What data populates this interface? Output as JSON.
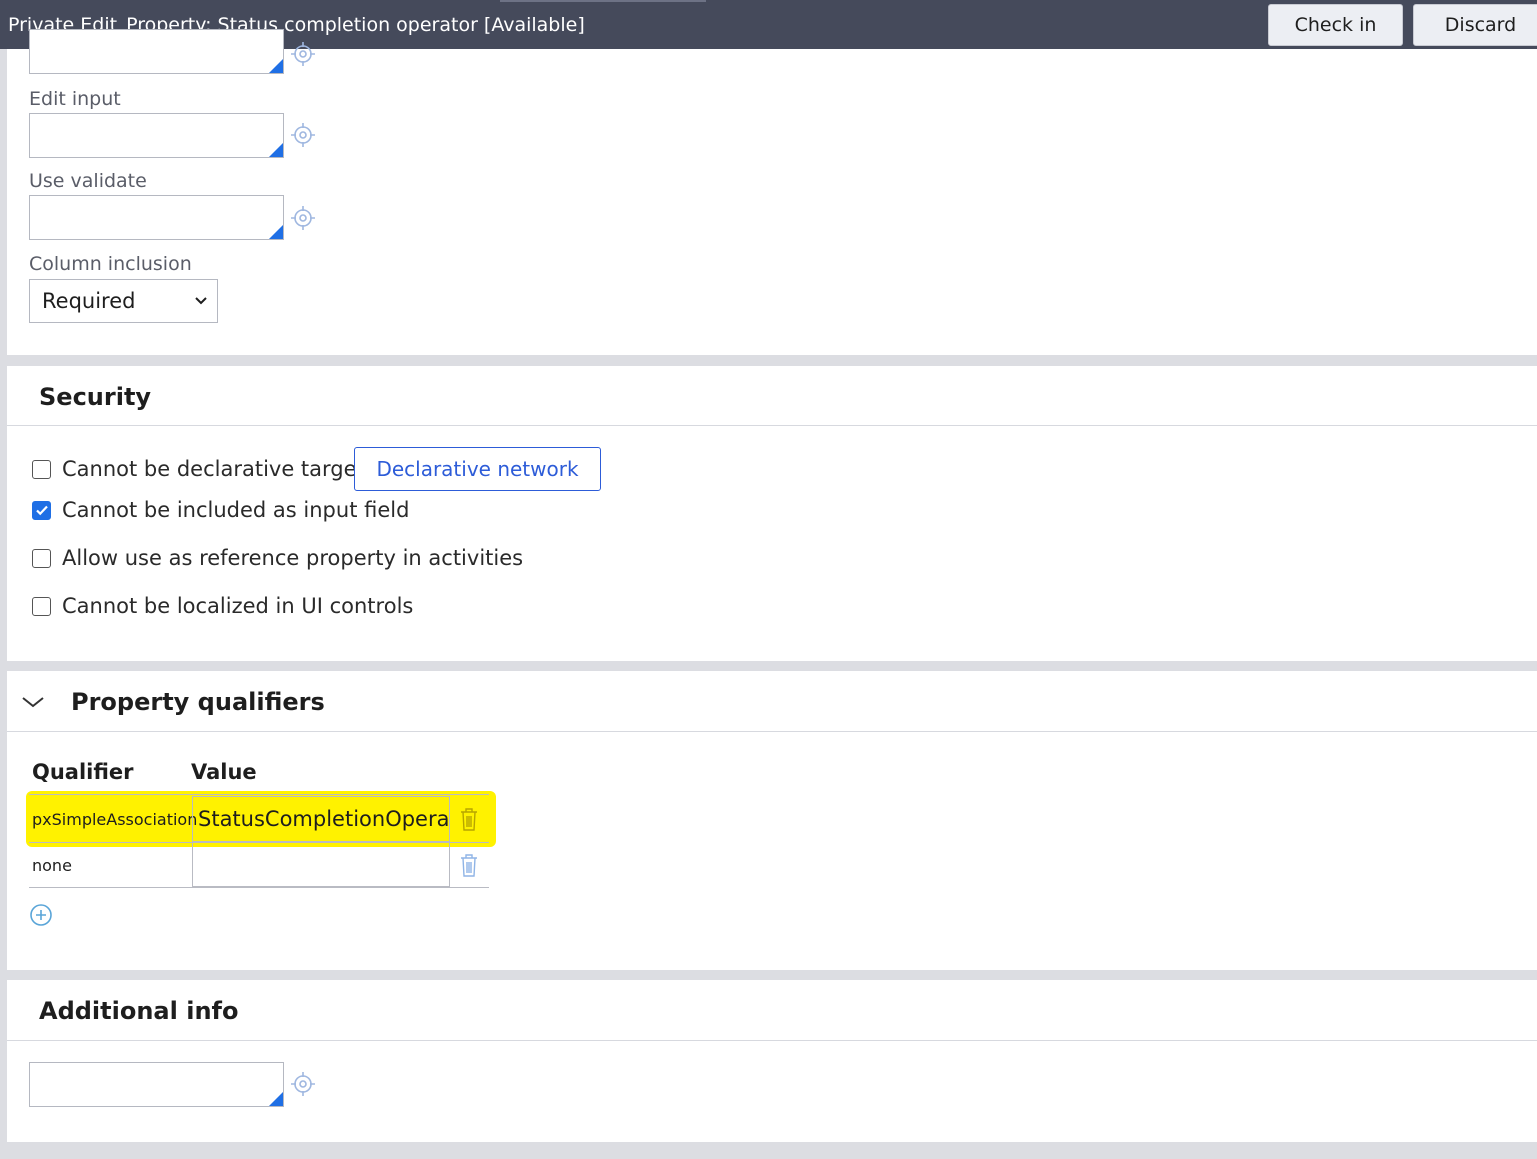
{
  "header": {
    "mode": "Private Edit",
    "title": "Property: Status completion operator [Available]",
    "checkin_label": "Check in",
    "discard_label": "Discard"
  },
  "fields": {
    "edit_input_label": "Edit input",
    "use_validate_label": "Use validate",
    "column_inclusion_label": "Column inclusion",
    "column_inclusion_value": "Required"
  },
  "security": {
    "title": "Security",
    "declarative_network_label": "Declarative network",
    "options": [
      {
        "label": "Cannot be declarative target",
        "checked": false
      },
      {
        "label": "Cannot be included as input field",
        "checked": true
      },
      {
        "label": "Allow use as reference property in activities",
        "checked": false
      },
      {
        "label": "Cannot be localized in UI controls",
        "checked": false
      }
    ]
  },
  "qualifiers": {
    "title": "Property qualifiers",
    "col_qualifier": "Qualifier",
    "col_value": "Value",
    "rows": [
      {
        "qualifier": "pxSimpleAssociation",
        "value": "StatusCompletionOperator"
      },
      {
        "qualifier": "none",
        "value": ""
      }
    ]
  },
  "additional": {
    "title": "Additional info"
  },
  "colors": {
    "header_bg": "#454a5b",
    "accent_blue": "#1f6fe5",
    "highlight": "#fff200"
  }
}
